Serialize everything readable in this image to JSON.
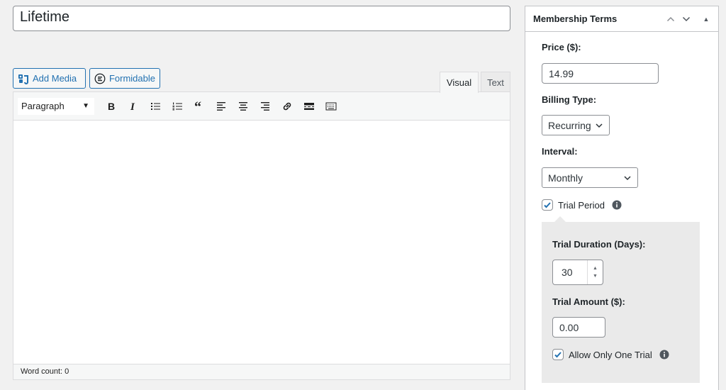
{
  "post": {
    "title": "Lifetime"
  },
  "media_buttons": {
    "add_media": "Add Media",
    "formidable": "Formidable"
  },
  "editor": {
    "tabs": {
      "visual": "Visual",
      "text": "Text"
    },
    "format": "Paragraph",
    "toolbar_icons": [
      "bold-icon",
      "italic-icon",
      "bulleted-list-icon",
      "numbered-list-icon",
      "blockquote-icon",
      "align-left-icon",
      "align-center-icon",
      "align-right-icon",
      "link-icon",
      "read-more-icon",
      "toolbar-toggle-icon"
    ],
    "word_count": "Word count: 0"
  },
  "panel": {
    "title": "Membership Terms",
    "price_label": "Price ($):",
    "price_value": "14.99",
    "billing_label": "Billing Type:",
    "billing_value": "Recurring",
    "interval_label": "Interval:",
    "interval_value": "Monthly",
    "trial_period_label": "Trial Period",
    "trial_period_checked": true,
    "trial_duration_label": "Trial Duration (Days):",
    "trial_duration_value": "30",
    "trial_amount_label": "Trial Amount ($):",
    "trial_amount_value": "0.00",
    "one_trial_label": "Allow Only One Trial",
    "one_trial_checked": true
  },
  "colors": {
    "accent": "#2271b1",
    "trial_bg": "#eaeaea",
    "page_bg": "#f1f1f1"
  }
}
